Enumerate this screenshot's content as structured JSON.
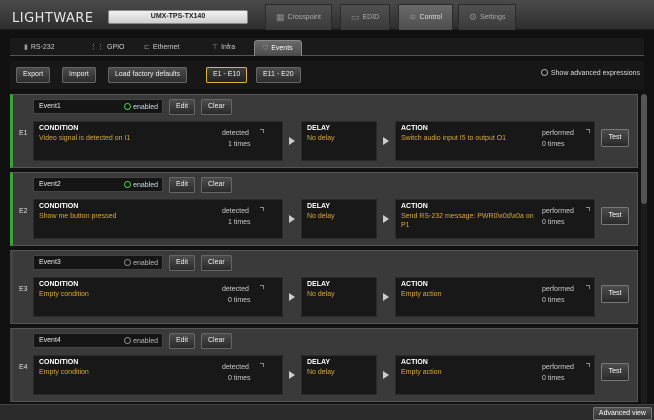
{
  "header": {
    "logo_small": "",
    "logo": "LIGHTWARE",
    "device": "UMX-TPS-TX140",
    "nav": [
      {
        "label": "Crosspoint",
        "icon": "grid-icon"
      },
      {
        "label": "EDID",
        "icon": "monitor-icon"
      },
      {
        "label": "Control",
        "icon": "control-icon"
      },
      {
        "label": "Settings",
        "icon": "gears-icon"
      }
    ]
  },
  "subtabs": [
    {
      "label": "RS-232",
      "icon": "serial-icon"
    },
    {
      "label": "GPIO",
      "icon": "gpio-icon"
    },
    {
      "label": "Ethernet",
      "icon": "ethernet-icon"
    },
    {
      "label": "Infra",
      "icon": "infra-icon"
    },
    {
      "label": "Events",
      "icon": "events-icon"
    }
  ],
  "toolbar": {
    "export": "Export",
    "import": "Import",
    "factory": "Load factory defaults",
    "range1": "E1 - E10",
    "range2": "E11 - E20",
    "advanced": "Show advanced expressions"
  },
  "labels": {
    "enabled": "enabled",
    "edit": "Edit",
    "clear": "Clear",
    "condition": "CONDITION",
    "delay": "DELAY",
    "action": "ACTION",
    "detected": "detected",
    "performed": "performed",
    "test": "Test"
  },
  "events": [
    {
      "name": "Event1",
      "id": "E1",
      "enabled": true,
      "condition": "Video signal is detected on I1",
      "detected": "1 times",
      "delay": "No delay",
      "action": "Switch audio input I5 to output O1",
      "performed": "0 times"
    },
    {
      "name": "Event2",
      "id": "E2",
      "enabled": true,
      "condition": "Show me button pressed",
      "detected": "1 times",
      "delay": "No delay",
      "action": "Send RS-232 message: PWR0\\x0d\\x0a on P1",
      "performed": "0 times"
    },
    {
      "name": "Event3",
      "id": "E3",
      "enabled": false,
      "condition": "Empty condition",
      "detected": "0 times",
      "delay": "No delay",
      "action": "Empty action",
      "performed": "0 times"
    },
    {
      "name": "Event4",
      "id": "E4",
      "enabled": false,
      "condition": "Empty condition",
      "detected": "0 times",
      "delay": "No delay",
      "action": "Empty action",
      "performed": "0 times"
    }
  ],
  "footer": {
    "advanced_view": "Advanced view"
  },
  "colors": {
    "accent": "#d7a93a",
    "enabled": "#3aa33a",
    "selected_border": "#e0b43c"
  }
}
